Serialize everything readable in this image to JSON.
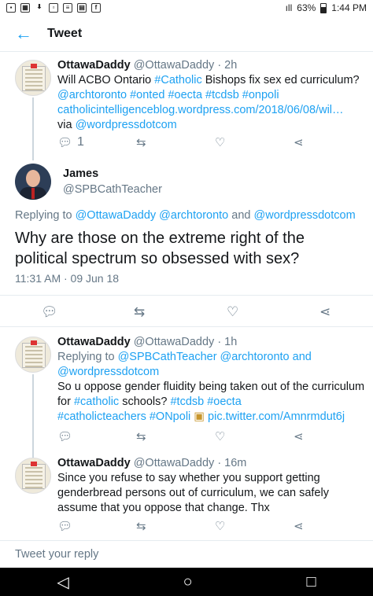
{
  "status_bar": {
    "icons": [
      "notification-icon",
      "calendar-icon",
      "download-icon",
      "app-icon",
      "message-icon",
      "news-icon",
      "facebook-icon"
    ],
    "signal": "ıll",
    "battery": "63%",
    "time": "1:44 PM"
  },
  "header": {
    "back_icon": "←",
    "title": "Tweet"
  },
  "tweet1": {
    "name": "OttawaDaddy",
    "handle": "@OttawaDaddy",
    "time": "· 2h",
    "text_a": "Will ACBO Ontario ",
    "tag_catholic": "#Catholic",
    "text_b": " Bishops fix sex ed curriculum?",
    "mentions_line": "@archtoronto #onted #oecta #tcdsb #onpoli",
    "link": "catholicintelligenceblog.wordpress.com/2018/06/08/wil…",
    "via": "via ",
    "via_mention": "@wordpressdotcom",
    "reply_count": "1"
  },
  "main_tweet": {
    "name": "James",
    "handle": "@SPBCathTeacher",
    "replying_prefix": "Replying to ",
    "replying_to": "@OttawaDaddy @archtoronto",
    "and": " and ",
    "replying_last": "@wordpressdotcom",
    "text": "Why are those on the extreme right of the political spectrum so obsessed with sex?",
    "timestamp": "11:31 AM · 09 Jun 18"
  },
  "tweet3": {
    "name": "OttawaDaddy",
    "handle": "@OttawaDaddy",
    "time": "· 1h",
    "replying_prefix": "Replying to ",
    "replying_to": "@SPBCathTeacher @archtoronto",
    "and": " and",
    "replying_last": "@wordpressdotcom",
    "text_a": "So u oppose gender fluidity being taken out of the curriculum for ",
    "tag_catholic": "#catholic",
    "text_b": " schools? ",
    "tags_1": "#tcdsb #oecta",
    "tags_2": "#catholicteachers #ONpoli",
    "pic": "pic.twitter.com/Amnrmdut6j"
  },
  "tweet4": {
    "name": "OttawaDaddy",
    "handle": "@OttawaDaddy",
    "time": "· 16m",
    "text": "Since you refuse to say whether you support getting genderbread persons out of curriculum, we can safely assume that you oppose that change. Thx"
  },
  "reply_box": {
    "placeholder": "Tweet your reply"
  },
  "nav": {
    "back": "◁",
    "home": "○",
    "recent": "□"
  }
}
